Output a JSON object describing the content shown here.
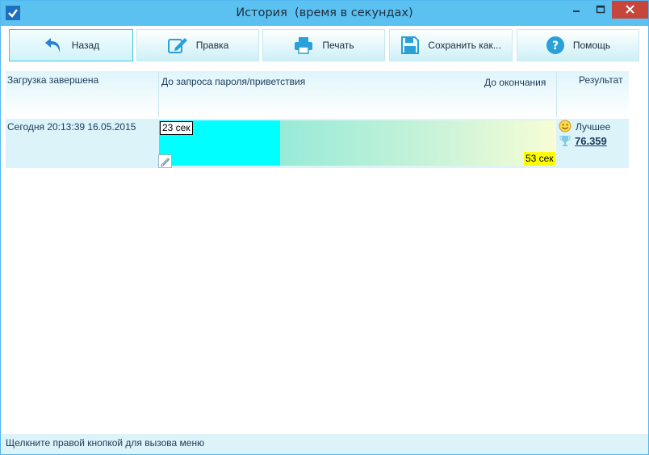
{
  "window": {
    "title": "История  (время в секундах)",
    "icons": {
      "app": "check-icon",
      "minimize": "minimize-icon",
      "maximize": "maximize-icon",
      "close": "close-icon"
    },
    "colors": {
      "titlebar": "#5bc1f0",
      "close": "#c7453b"
    }
  },
  "toolbar": {
    "buttons": [
      {
        "label": "Назад",
        "icon": "back-arrow-icon"
      },
      {
        "label": "Правка",
        "icon": "edit-icon"
      },
      {
        "label": "Печать",
        "icon": "printer-icon"
      },
      {
        "label": "Сохранить как...",
        "icon": "save-icon"
      },
      {
        "label": "Помощь",
        "icon": "help-icon"
      }
    ]
  },
  "table": {
    "headers": {
      "loaded": "Загрузка завершена",
      "to_password": "До запроса пароля/приветствия",
      "to_end": "До окончания",
      "result": "Результат"
    },
    "rows": [
      {
        "loaded": "Сегодня  20:13:39 16.05.2015",
        "to_password": "23 сек",
        "to_end": "53 сек",
        "result_label": "Лучшее",
        "result_score": "76.359"
      }
    ],
    "colors": {
      "segment1": "#00ffff",
      "segment2_start": "#97ead8",
      "segment2_end": "#f7fdd5",
      "end_tag": "#ffff00"
    }
  },
  "status": {
    "text": "Щелкните правой кнопкой для вызова меню"
  }
}
